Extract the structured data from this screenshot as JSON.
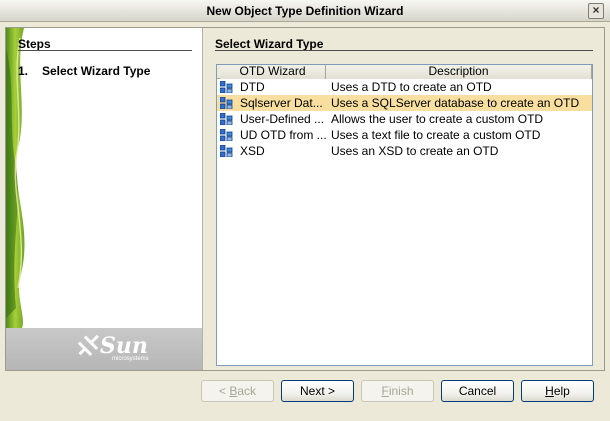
{
  "window": {
    "title": "New Object Type Definition Wizard",
    "close_glyph": "×"
  },
  "steps": {
    "heading": "Steps",
    "items": [
      {
        "number": "1.",
        "label": "Select Wizard Type"
      }
    ]
  },
  "branding": {
    "logo_text": "Sun",
    "logo_subtext": "microsystems"
  },
  "main": {
    "heading": "Select Wizard Type",
    "table": {
      "columns": [
        "OTD Wizard",
        "Description"
      ],
      "rows": [
        {
          "wizard": "DTD",
          "description": "Uses a DTD to create an OTD",
          "selected": false,
          "icon": "otd-wizard-icon"
        },
        {
          "wizard": "Sqlserver Dat...",
          "description": "Uses a SQLServer database to create an OTD",
          "selected": true,
          "icon": "otd-wizard-icon"
        },
        {
          "wizard": "User-Defined ...",
          "description": "Allows the user to create a custom OTD",
          "selected": false,
          "icon": "otd-wizard-icon"
        },
        {
          "wizard": "UD OTD from ...",
          "description": "Uses a text file to create a custom OTD",
          "selected": false,
          "icon": "otd-wizard-icon"
        },
        {
          "wizard": "XSD",
          "description": "Uses an XSD to create an OTD",
          "selected": false,
          "icon": "otd-wizard-icon"
        }
      ]
    }
  },
  "buttons": {
    "back": {
      "prefix": "< ",
      "mnemonic": "B",
      "rest": "ack",
      "enabled": false
    },
    "next": {
      "label": "Next >",
      "enabled": true
    },
    "finish": {
      "mnemonic": "F",
      "rest": "inish",
      "enabled": false
    },
    "cancel": {
      "label": "Cancel",
      "enabled": true
    },
    "help": {
      "mnemonic": "H",
      "rest": "elp",
      "enabled": true
    }
  },
  "colors": {
    "selection": "#f8df9f",
    "window_bg": "#ece9d8",
    "button_border": "#003c74"
  }
}
